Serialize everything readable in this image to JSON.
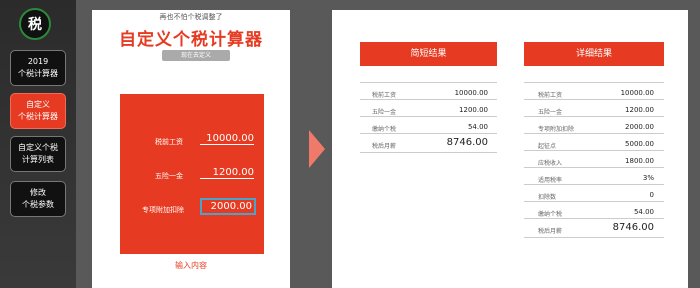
{
  "logo": "税",
  "nav": [
    {
      "label": "2019\n个税计算器",
      "active": false
    },
    {
      "label": "自定义\n个税计算器",
      "active": true
    },
    {
      "label": "自定义个税\n计算列表",
      "active": false
    },
    {
      "label": "修改\n个税参数",
      "active": false
    }
  ],
  "left": {
    "hint": "再也不怕个税调整了",
    "title": "自定义个税计算器",
    "badge": "现在去定义",
    "fields": [
      {
        "label": "税前工资",
        "value": "10000.00"
      },
      {
        "label": "五险一金",
        "value": "1200.00"
      },
      {
        "label": "专项附加扣除",
        "value": "2000.00"
      }
    ],
    "submit": "输入内容"
  },
  "summary": {
    "title": "简短结果",
    "rows": [
      {
        "label": "税前工资",
        "value": "10000.00"
      },
      {
        "label": "五险一金",
        "value": "1200.00"
      },
      {
        "label": "缴纳个税",
        "value": "54.00"
      },
      {
        "label": "税后月薪",
        "value": "8746.00"
      }
    ]
  },
  "detail": {
    "title": "详细结果",
    "rows": [
      {
        "label": "税前工资",
        "value": "10000.00"
      },
      {
        "label": "五险一金",
        "value": "1200.00"
      },
      {
        "label": "专项附加扣除",
        "value": "2000.00"
      },
      {
        "label": "起征点",
        "value": "5000.00"
      },
      {
        "label": "应税收入",
        "value": "1800.00"
      },
      {
        "label": "适用税率",
        "value": "3%"
      },
      {
        "label": "扣除数",
        "value": "0"
      },
      {
        "label": "缴纳个税",
        "value": "54.00"
      },
      {
        "label": "税后月薪",
        "value": "8746.00"
      }
    ]
  }
}
